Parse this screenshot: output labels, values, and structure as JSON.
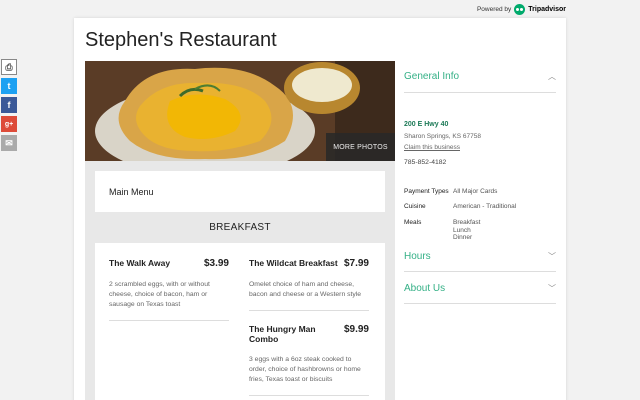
{
  "powered_by": {
    "label": "Powered by",
    "brand": "Tripadvisor"
  },
  "share": {
    "icons": [
      "print-icon",
      "twitter-icon",
      "facebook-icon",
      "google-plus-icon",
      "email-icon"
    ]
  },
  "restaurant": {
    "name": "Stephen's Restaurant"
  },
  "photo": {
    "more_label": "MORE PHOTOS"
  },
  "menu": {
    "title": "Main Menu",
    "section": "BREAKFAST",
    "items": [
      {
        "name": "The Walk Away",
        "price": "$3.99",
        "desc": "2 scrambled eggs, with or without cheese, choice of bacon, ham or sausage on Texas toast"
      },
      {
        "name": "The Wildcat Breakfast",
        "price": "$7.99",
        "desc": "Omelet choice of ham and cheese, bacon and cheese or a Western style"
      },
      {
        "name": "The Hungry Man Combo",
        "price": "$9.99",
        "desc": "3 eggs with a 6oz steak cooked to order, choice of hashbrowns or home fries, Texas toast or biscuits"
      }
    ]
  },
  "general_info": {
    "title": "General Info",
    "address_line1": "200 E Hwy 40",
    "address_line2": "Sharon Springs, KS 67758",
    "claim": "Claim this business",
    "phone": "785-852-4182",
    "payment_label": "Payment Types",
    "payment_value": "All Major Cards",
    "cuisine_label": "Cuisine",
    "cuisine_value": "American - Traditional",
    "meals_label": "Meals",
    "meals": [
      "Breakfast",
      "Lunch",
      "Dinner"
    ]
  },
  "hours": {
    "title": "Hours"
  },
  "about": {
    "title": "About Us"
  },
  "colors": {
    "accent": "#34b086",
    "tripadvisor": "#00aa6c"
  }
}
